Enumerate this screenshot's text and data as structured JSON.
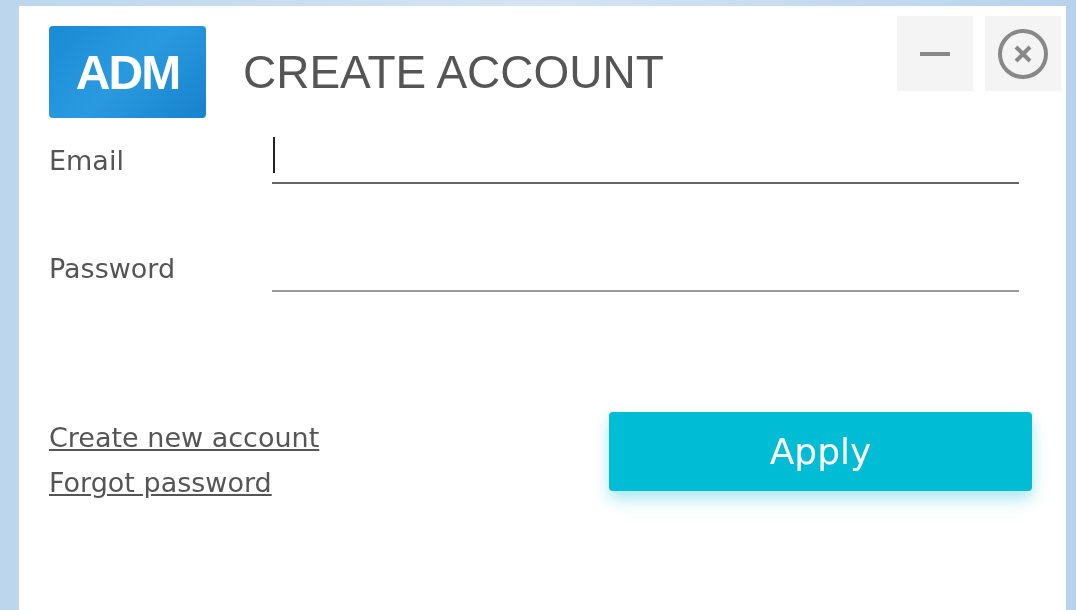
{
  "window": {
    "logo": "ADM",
    "title": "CREATE ACCOUNT"
  },
  "fields": [
    {
      "label": "Email",
      "focused": true
    },
    {
      "label": "Password",
      "focused": false
    }
  ],
  "links": [
    "Create new account",
    "Forgot password"
  ],
  "buttons": [
    "Apply"
  ]
}
